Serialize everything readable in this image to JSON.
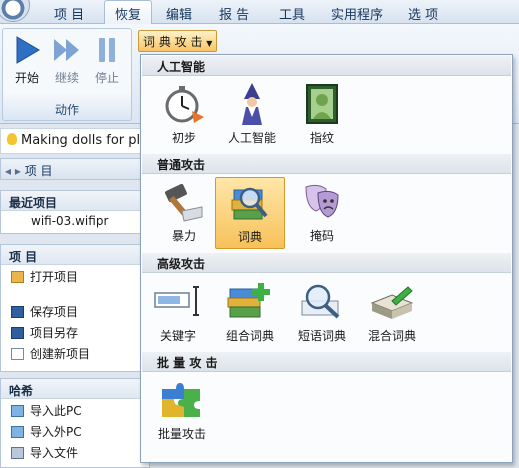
{
  "menu": [
    "项 目",
    "恢复",
    "编辑",
    "报 告",
    "工具",
    "实用程序",
    "选 项"
  ],
  "ribbon": {
    "buttons": [
      {
        "label": "开始",
        "icon": "play-icon"
      },
      {
        "label": "继续",
        "icon": "fast-forward-icon"
      },
      {
        "label": "停止",
        "icon": "pause-icon"
      }
    ],
    "group_label": "动作",
    "dict_button": "词 典 攻 击"
  },
  "notice": "Making dolls for plea",
  "nav_header": "项 目",
  "left_panel": {
    "recent": {
      "title": "最近项目",
      "items": [
        "wifi-03.wifipr"
      ]
    },
    "project": {
      "title": "项 目",
      "items": [
        "打开项目",
        "保存项目",
        "项目另存",
        "创建新项目"
      ]
    },
    "hash": {
      "title": "哈希",
      "items": [
        "导入此PC",
        "导入外PC",
        "导入文件"
      ]
    }
  },
  "dropdown": {
    "categories": [
      {
        "title": "人工智能",
        "items": [
          {
            "label": "初步",
            "icon": "stopwatch-icon"
          },
          {
            "label": "人工智能",
            "icon": "wizard-icon"
          },
          {
            "label": "指纹",
            "icon": "fingerprint-portrait-icon"
          }
        ]
      },
      {
        "title": "普通攻击",
        "items": [
          {
            "label": "暴力",
            "icon": "hammer-icon"
          },
          {
            "label": "词典",
            "icon": "dictionary-search-icon",
            "selected": true
          },
          {
            "label": "掩码",
            "icon": "theater-masks-icon"
          }
        ]
      },
      {
        "title": "高级攻击",
        "items": [
          {
            "label": "关键字",
            "icon": "keyword-field-icon"
          },
          {
            "label": "组合词典",
            "icon": "stacked-books-plus-icon"
          },
          {
            "label": "短语词典",
            "icon": "phrase-search-icon"
          },
          {
            "label": "混合词典",
            "icon": "hybrid-book-icon"
          }
        ]
      },
      {
        "title": "批 量 攻 击",
        "items": [
          {
            "label": "批量攻击",
            "icon": "puzzle-icon"
          }
        ]
      }
    ]
  },
  "colors": {
    "accent": "#f7c15a",
    "blue": "#2f6fc4",
    "menu_text": "#15365d"
  }
}
